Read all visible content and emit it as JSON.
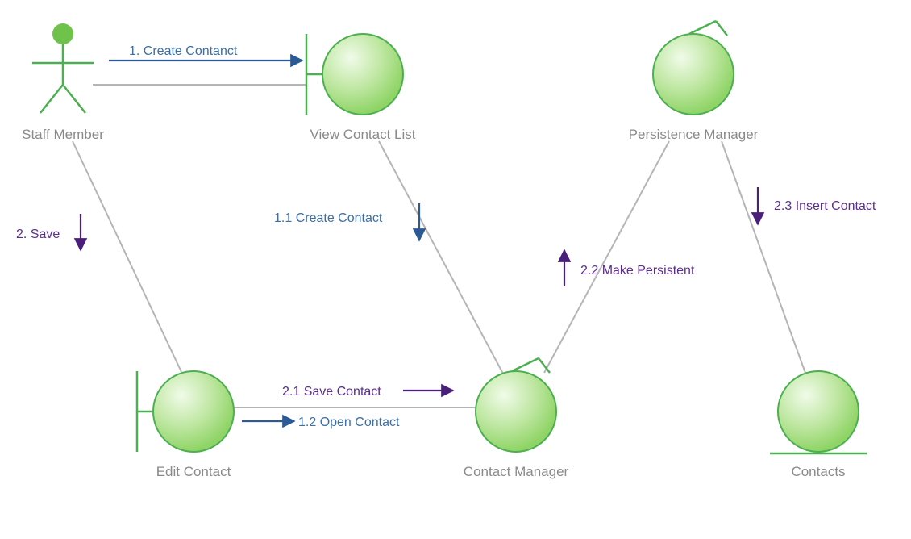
{
  "colors": {
    "green_stroke": "#4caf50",
    "green_fill_light": "#e8f7e4",
    "green_fill_dark": "#8fd466",
    "gray_line": "#b5b5b5",
    "gray_text": "#8a8a8a",
    "blue_text": "#3a6ea5",
    "blue_arrow": "#2c5a94",
    "purple_text": "#5b2d8e",
    "purple_arrow": "#4a1f7a"
  },
  "nodes": {
    "staff_member": {
      "label": "Staff Member"
    },
    "view_contact_list": {
      "label": "View Contact List"
    },
    "persistence_manager": {
      "label": "Persistence Manager"
    },
    "edit_contact": {
      "label": "Edit Contact"
    },
    "contact_manager": {
      "label": "Contact Manager"
    },
    "contacts": {
      "label": "Contacts"
    }
  },
  "messages": {
    "create_contanct": "1. Create Contanct",
    "create_contact": "1.1 Create Contact",
    "open_contact": "1.2 Open Contact",
    "save": "2. Save",
    "save_contact": "2.1 Save Contact",
    "make_persistent": "2.2 Make Persistent",
    "insert_contact": "2.3 Insert Contact"
  }
}
